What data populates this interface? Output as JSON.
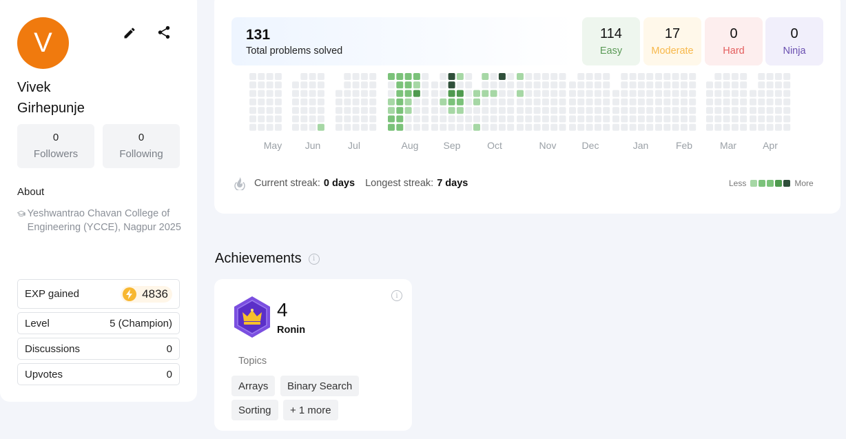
{
  "profile": {
    "avatar_letter": "V",
    "name": "Vivek Girhepunje",
    "followers": {
      "count": "0",
      "label": "Followers"
    },
    "following": {
      "count": "0",
      "label": "Following"
    },
    "about_title": "About",
    "college": "Yeshwantrao Chavan College of Engineering (YCCE), Nagpur 2025",
    "stats": {
      "exp_label": "EXP gained",
      "exp_value": "4836",
      "level_label": "Level",
      "level_value": "5 (Champion)",
      "discussions_label": "Discussions",
      "discussions_value": "0",
      "upvotes_label": "Upvotes",
      "upvotes_value": "0"
    }
  },
  "problems": {
    "total": "131",
    "total_label": "Total problems solved",
    "easy": {
      "count": "114",
      "label": "Easy",
      "color": "#5b9a57",
      "bg": "#eef6ee"
    },
    "moderate": {
      "count": "17",
      "label": "Moderate",
      "color": "#f7b84b",
      "bg": "#fff8ea"
    },
    "hard": {
      "count": "0",
      "label": "Hard",
      "color": "#e35d5d",
      "bg": "#fdeeee"
    },
    "ninja": {
      "count": "0",
      "label": "Ninja",
      "color": "#6a4fb0",
      "bg": "#f1effb"
    }
  },
  "heatmap": {
    "months": [
      "May",
      "Jun",
      "Jul",
      "Aug",
      "Sep",
      "Oct",
      "Nov",
      "Dec",
      "Jan",
      "Feb",
      "Mar",
      "Apr"
    ],
    "colors": {
      "empty": "#ebedf0",
      "l1": "#a6d7a5",
      "l2": "#7bc27a",
      "l3": "#4f9a4f",
      "l4": "#2f4f3a"
    }
  },
  "streak": {
    "current_label": "Current streak:",
    "current_value": "0 days",
    "longest_label": "Longest streak:",
    "longest_value": "7 days"
  },
  "legend": {
    "less": "Less",
    "more": "More"
  },
  "achievements": {
    "title": "Achievements",
    "number": "4",
    "rank": "Ronin",
    "topics_label": "Topics",
    "topics": [
      "Arrays",
      "Binary Search",
      "Sorting",
      "+ 1 more"
    ]
  }
}
